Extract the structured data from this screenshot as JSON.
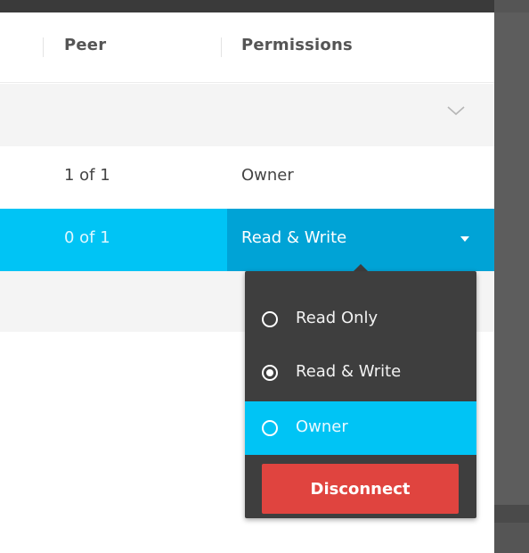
{
  "table": {
    "columns": {
      "peer": "Peer",
      "permissions": "Permissions"
    },
    "rows": [
      {
        "peer": "1 of 1",
        "permission": "Owner"
      },
      {
        "peer": "0 of 1",
        "permission": "Read & Write",
        "selected": true
      }
    ]
  },
  "permission_menu": {
    "options": [
      {
        "label": "Read Only",
        "checked": false
      },
      {
        "label": "Read & Write",
        "checked": true
      },
      {
        "label": "Owner",
        "checked": false,
        "highlighted": true
      }
    ],
    "disconnect_label": "Disconnect"
  },
  "icons": {
    "group_toggle": "chevron-down-icon",
    "select_caret": "caret-down-icon",
    "option_radio": "radio-icon"
  },
  "colors": {
    "selected_row": "#00c4f5",
    "select_bg": "#00a3d6",
    "menu_bg": "#3e3e3e",
    "danger": "#e0443f",
    "header_text": "#555555"
  }
}
